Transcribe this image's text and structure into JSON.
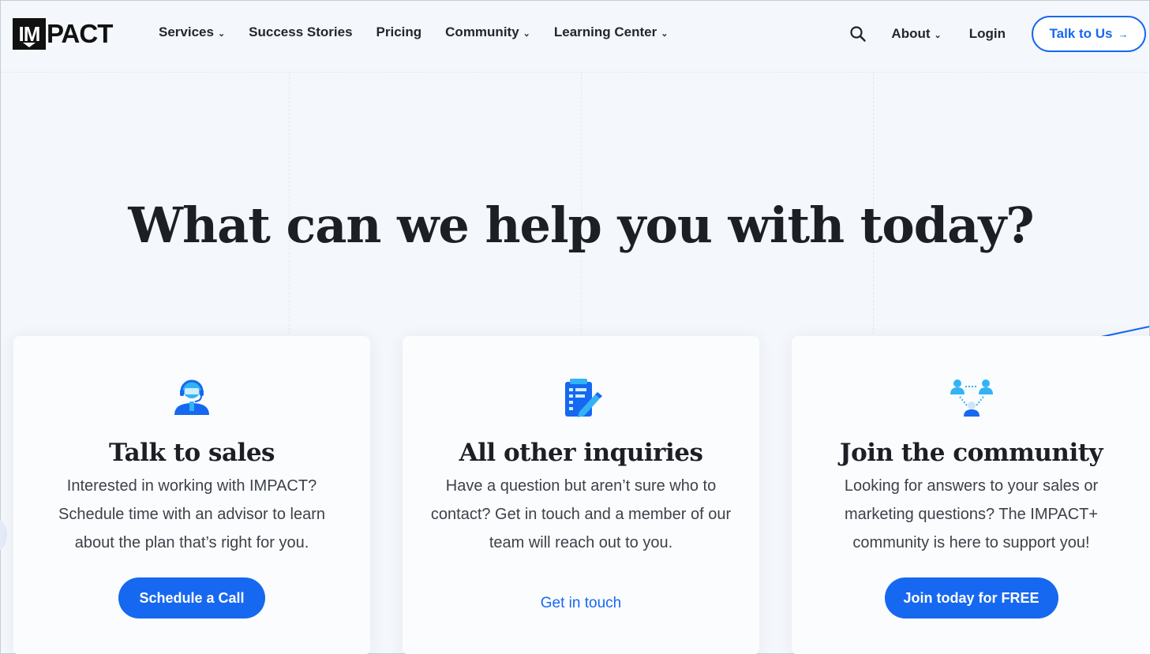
{
  "brand": {
    "logo_box_text": "IM",
    "logo_text": "PACT"
  },
  "nav": {
    "items": [
      {
        "label": "Services",
        "dropdown": true
      },
      {
        "label": "Success Stories",
        "dropdown": false
      },
      {
        "label": "Pricing",
        "dropdown": false
      },
      {
        "label": "Community",
        "dropdown": true
      },
      {
        "label": "Learning Center",
        "dropdown": true
      }
    ],
    "about": "About",
    "login": "Login",
    "cta": "Talk to Us",
    "cta_arrow": "→",
    "chevron": "⌄"
  },
  "hero": {
    "title": "What can we help you with today?"
  },
  "cards": [
    {
      "icon": "headset-agent-icon",
      "title": "Talk to sales",
      "body": "Interested in working with IMPACT? Schedule time with an advisor to learn about the plan that’s right for you.",
      "action": "Schedule a Call"
    },
    {
      "icon": "clipboard-pencil-icon",
      "title": "All other inquiries",
      "body": "Have a question but aren’t sure who to contact? Get in touch and a member of our team will reach out to you.",
      "action": "Get in touch"
    },
    {
      "icon": "community-people-icon",
      "title": "Join the community",
      "body": "Looking for answers to your sales or marketing questions? The IMPACT+ community is here to support you!",
      "action": "Join today for FREE"
    }
  ],
  "colors": {
    "accent": "#1668f0",
    "icon_light": "#33b3f5",
    "background": "#f4f7fb"
  }
}
